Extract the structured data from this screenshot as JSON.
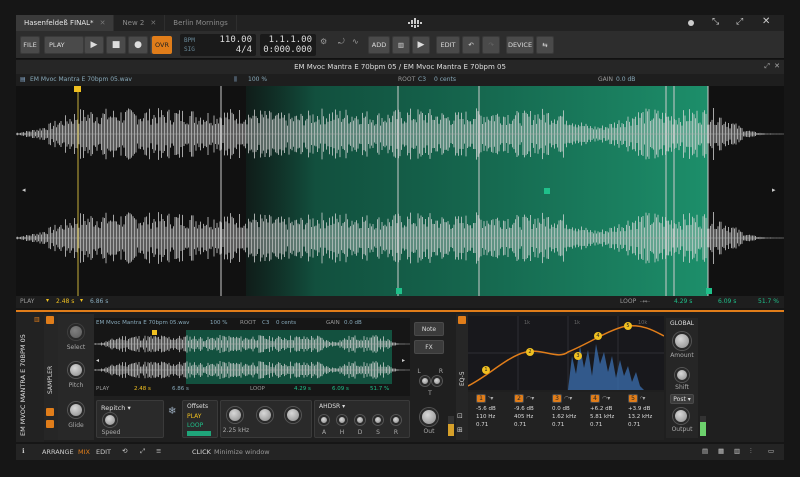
{
  "tabs": [
    {
      "label": "Hasenfeldeß FINAL*",
      "active": true
    },
    {
      "label": "New 2",
      "active": false
    },
    {
      "label": "Berlin Mornings",
      "active": false
    }
  ],
  "transport": {
    "file": "FILE",
    "play": "PLAY",
    "ovr": "OVR",
    "tempo": "110.00",
    "sig": "4/4",
    "pos": "1.1.1.00",
    "time": "0:000.000",
    "add": "ADD",
    "edit": "EDIT",
    "device": "DEVICE",
    "bpm_icon_label": "BPM",
    "sig_icon_label": "SIG"
  },
  "editor": {
    "title": "EM Mvoc Mantra E 70bpm 05 / EM Mvoc Mantra E 70bpm 05",
    "file": "EM Mvoc Mantra E 70bpm 05.wav",
    "zoom": "100 %",
    "root_label": "ROOT",
    "root_val": "C3",
    "cents": "0 cents",
    "gain_label": "GAIN",
    "gain_val": "0.0 dB",
    "play_label": "PLAY",
    "play_start": "2.48 s",
    "play_end": "6.86 s",
    "loop_label": "LOOP",
    "loop_start": "4.29 s",
    "loop_end": "6.09 s",
    "loop_pct": "51.7 %"
  },
  "device": {
    "track": "EM MVOC MANTRA E 70BPM 05",
    "sampler": "SAMPLER",
    "select": "Select",
    "pitch": "Pitch",
    "glide": "Glide",
    "file": "EM Mvoc Mantra E 70bpm 05.wav",
    "zoom": "100 %",
    "root_label": "ROOT",
    "root_val": "C3",
    "cents": "0 cents",
    "gain_label": "GAIN",
    "gain_val": "0.0 dB",
    "play_label": "PLAY",
    "play_start": "2.48 s",
    "play_end": "6.86 s",
    "loop_label": "LOOP",
    "loop_start": "4.29 s",
    "loop_end": "6.09 s",
    "loop_pct": "51.7 %",
    "mode": "Repitch",
    "speed": "Speed",
    "offsets": "Offsets",
    "off_play": "PLAY",
    "off_loop": "LOOP",
    "filter_freq": "2.25 kHz",
    "ahdsr": "AHDSR",
    "a": "A",
    "h": "H",
    "d": "D",
    "s": "S",
    "r": "R",
    "note": "Note",
    "fx": "FX",
    "l": "L",
    "rr": "R",
    "t": "T",
    "out": "Out",
    "eq": "EQ-5",
    "global": "GLOBAL",
    "amount": "Amount",
    "shift": "Shift",
    "post": "Post",
    "output": "Output",
    "bands": [
      {
        "n": "1",
        "gain": "-5.6 dB",
        "freq": "110 Hz",
        "q": "0.71"
      },
      {
        "n": "2",
        "gain": "-9.6 dB",
        "freq": "405 Hz",
        "q": "0.71"
      },
      {
        "n": "3",
        "gain": "0.0 dB",
        "freq": "1.62 kHz",
        "q": "0.71"
      },
      {
        "n": "4",
        "gain": "+6.2 dB",
        "freq": "5.81 kHz",
        "q": "0.71"
      },
      {
        "n": "5",
        "gain": "+3.9 dB",
        "freq": "13.2 kHz",
        "q": "0.71"
      }
    ],
    "grid": [
      "1k",
      "10k",
      "1k"
    ]
  },
  "bottom": {
    "arrange": "ARRANGE",
    "mix": "MIX",
    "edit": "EDIT",
    "click": "CLICK",
    "hint": "Minimize window"
  },
  "colors": {
    "accent": "#e07d1a",
    "loop": "#1fa57a",
    "wave": "#d8d8d8"
  }
}
